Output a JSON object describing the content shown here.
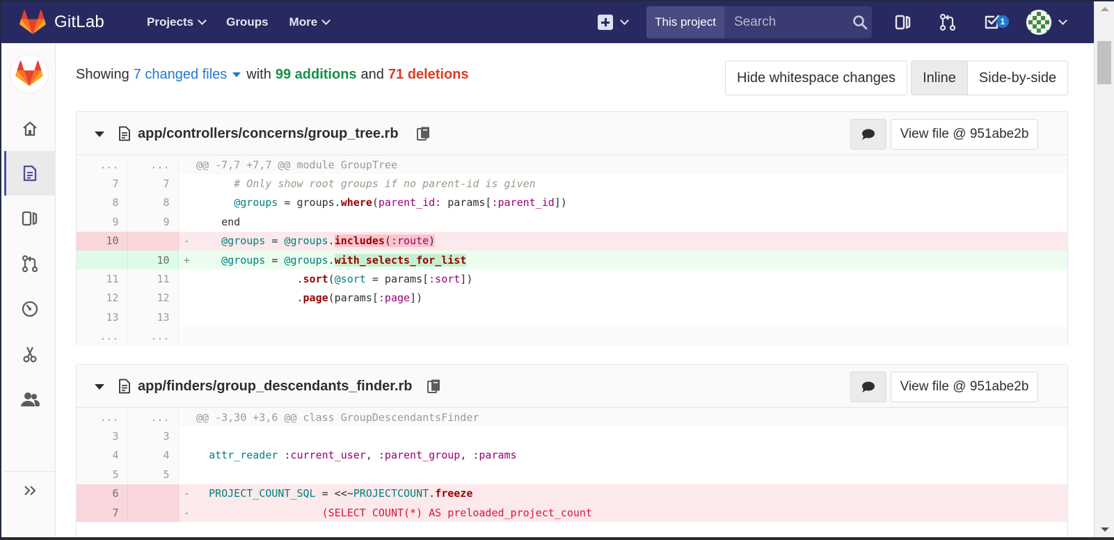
{
  "navbar": {
    "brand": "GitLab",
    "links": [
      {
        "label": "Projects",
        "has_caret": true
      },
      {
        "label": "Groups",
        "has_caret": false
      },
      {
        "label": "More",
        "has_caret": true
      }
    ],
    "search_scope": "This project",
    "search_placeholder": "Search",
    "todo_count": "1",
    "colors": {
      "bar": "#292961",
      "accent": "#1f78d1"
    }
  },
  "sidebar": {
    "items": [
      "home-icon",
      "repository-icon",
      "issues-icon",
      "merge-requests-icon",
      "ci-cd-icon",
      "snippets-icon",
      "members-icon"
    ],
    "active": "repository-icon"
  },
  "diff_stats": {
    "showing": "Showing",
    "changed_files": "7 changed files",
    "with": "with",
    "additions": "99 additions",
    "and": "and",
    "deletions": "71 deletions"
  },
  "toolbar": {
    "hide_whitespace": "Hide whitespace changes",
    "inline": "Inline",
    "side_by_side": "Side-by-side"
  },
  "files": [
    {
      "path": "app/controllers/concerns/group_tree.rb",
      "view_file": "View file @ 951abe2b",
      "lines": [
        {
          "type": "match",
          "old": "...",
          "new": "...",
          "sign": "",
          "code": "@@ -7,7 +7,7 @@ module GroupTree"
        },
        {
          "type": "ctx",
          "old": "7",
          "new": "7",
          "sign": "",
          "code": "      # Only show root groups if no parent-id is given"
        },
        {
          "type": "ctx",
          "old": "8",
          "new": "8",
          "sign": "",
          "code": "      @groups = groups.where(parent_id: params[:parent_id])"
        },
        {
          "type": "ctx",
          "old": "9",
          "new": "9",
          "sign": "",
          "code": "    end"
        },
        {
          "type": "old",
          "old": "10",
          "new": "",
          "sign": "-",
          "code": "    @groups = @groups.includes(:route)"
        },
        {
          "type": "new",
          "old": "",
          "new": "10",
          "sign": "+",
          "code": "    @groups = @groups.with_selects_for_list"
        },
        {
          "type": "ctx",
          "old": "11",
          "new": "11",
          "sign": "",
          "code": "                .sort(@sort = params[:sort])"
        },
        {
          "type": "ctx",
          "old": "12",
          "new": "12",
          "sign": "",
          "code": "                .page(params[:page])"
        },
        {
          "type": "ctx",
          "old": "13",
          "new": "13",
          "sign": "",
          "code": ""
        },
        {
          "type": "match",
          "old": "...",
          "new": "...",
          "sign": "",
          "code": ""
        }
      ]
    },
    {
      "path": "app/finders/group_descendants_finder.rb",
      "view_file": "View file @ 951abe2b",
      "lines": [
        {
          "type": "match",
          "old": "...",
          "new": "...",
          "sign": "",
          "code": "@@ -3,30 +3,6 @@ class GroupDescendantsFinder"
        },
        {
          "type": "ctx",
          "old": "3",
          "new": "3",
          "sign": "",
          "code": ""
        },
        {
          "type": "ctx",
          "old": "4",
          "new": "4",
          "sign": "",
          "code": "  attr_reader :current_user, :parent_group, :params"
        },
        {
          "type": "ctx",
          "old": "5",
          "new": "5",
          "sign": "",
          "code": ""
        },
        {
          "type": "old",
          "old": "6",
          "new": "",
          "sign": "-",
          "code": "  PROJECT_COUNT_SQL = <<~PROJECTCOUNT.freeze"
        },
        {
          "type": "old",
          "old": "7",
          "new": "",
          "sign": "-",
          "code": "                    (SELECT COUNT(*) AS preloaded_project_count"
        }
      ]
    }
  ]
}
